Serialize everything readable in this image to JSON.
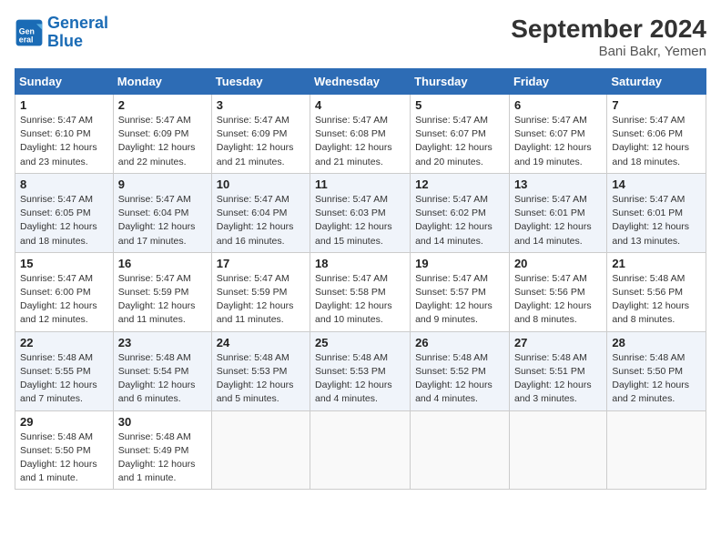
{
  "header": {
    "logo_general": "General",
    "logo_blue": "Blue",
    "month_year": "September 2024",
    "location": "Bani Bakr, Yemen"
  },
  "days_of_week": [
    "Sunday",
    "Monday",
    "Tuesday",
    "Wednesday",
    "Thursday",
    "Friday",
    "Saturday"
  ],
  "weeks": [
    [
      {
        "day": "1",
        "sunrise": "Sunrise: 5:47 AM",
        "sunset": "Sunset: 6:10 PM",
        "daylight": "Daylight: 12 hours and 23 minutes."
      },
      {
        "day": "2",
        "sunrise": "Sunrise: 5:47 AM",
        "sunset": "Sunset: 6:09 PM",
        "daylight": "Daylight: 12 hours and 22 minutes."
      },
      {
        "day": "3",
        "sunrise": "Sunrise: 5:47 AM",
        "sunset": "Sunset: 6:09 PM",
        "daylight": "Daylight: 12 hours and 21 minutes."
      },
      {
        "day": "4",
        "sunrise": "Sunrise: 5:47 AM",
        "sunset": "Sunset: 6:08 PM",
        "daylight": "Daylight: 12 hours and 21 minutes."
      },
      {
        "day": "5",
        "sunrise": "Sunrise: 5:47 AM",
        "sunset": "Sunset: 6:07 PM",
        "daylight": "Daylight: 12 hours and 20 minutes."
      },
      {
        "day": "6",
        "sunrise": "Sunrise: 5:47 AM",
        "sunset": "Sunset: 6:07 PM",
        "daylight": "Daylight: 12 hours and 19 minutes."
      },
      {
        "day": "7",
        "sunrise": "Sunrise: 5:47 AM",
        "sunset": "Sunset: 6:06 PM",
        "daylight": "Daylight: 12 hours and 18 minutes."
      }
    ],
    [
      {
        "day": "8",
        "sunrise": "Sunrise: 5:47 AM",
        "sunset": "Sunset: 6:05 PM",
        "daylight": "Daylight: 12 hours and 18 minutes."
      },
      {
        "day": "9",
        "sunrise": "Sunrise: 5:47 AM",
        "sunset": "Sunset: 6:04 PM",
        "daylight": "Daylight: 12 hours and 17 minutes."
      },
      {
        "day": "10",
        "sunrise": "Sunrise: 5:47 AM",
        "sunset": "Sunset: 6:04 PM",
        "daylight": "Daylight: 12 hours and 16 minutes."
      },
      {
        "day": "11",
        "sunrise": "Sunrise: 5:47 AM",
        "sunset": "Sunset: 6:03 PM",
        "daylight": "Daylight: 12 hours and 15 minutes."
      },
      {
        "day": "12",
        "sunrise": "Sunrise: 5:47 AM",
        "sunset": "Sunset: 6:02 PM",
        "daylight": "Daylight: 12 hours and 14 minutes."
      },
      {
        "day": "13",
        "sunrise": "Sunrise: 5:47 AM",
        "sunset": "Sunset: 6:01 PM",
        "daylight": "Daylight: 12 hours and 14 minutes."
      },
      {
        "day": "14",
        "sunrise": "Sunrise: 5:47 AM",
        "sunset": "Sunset: 6:01 PM",
        "daylight": "Daylight: 12 hours and 13 minutes."
      }
    ],
    [
      {
        "day": "15",
        "sunrise": "Sunrise: 5:47 AM",
        "sunset": "Sunset: 6:00 PM",
        "daylight": "Daylight: 12 hours and 12 minutes."
      },
      {
        "day": "16",
        "sunrise": "Sunrise: 5:47 AM",
        "sunset": "Sunset: 5:59 PM",
        "daylight": "Daylight: 12 hours and 11 minutes."
      },
      {
        "day": "17",
        "sunrise": "Sunrise: 5:47 AM",
        "sunset": "Sunset: 5:59 PM",
        "daylight": "Daylight: 12 hours and 11 minutes."
      },
      {
        "day": "18",
        "sunrise": "Sunrise: 5:47 AM",
        "sunset": "Sunset: 5:58 PM",
        "daylight": "Daylight: 12 hours and 10 minutes."
      },
      {
        "day": "19",
        "sunrise": "Sunrise: 5:47 AM",
        "sunset": "Sunset: 5:57 PM",
        "daylight": "Daylight: 12 hours and 9 minutes."
      },
      {
        "day": "20",
        "sunrise": "Sunrise: 5:47 AM",
        "sunset": "Sunset: 5:56 PM",
        "daylight": "Daylight: 12 hours and 8 minutes."
      },
      {
        "day": "21",
        "sunrise": "Sunrise: 5:48 AM",
        "sunset": "Sunset: 5:56 PM",
        "daylight": "Daylight: 12 hours and 8 minutes."
      }
    ],
    [
      {
        "day": "22",
        "sunrise": "Sunrise: 5:48 AM",
        "sunset": "Sunset: 5:55 PM",
        "daylight": "Daylight: 12 hours and 7 minutes."
      },
      {
        "day": "23",
        "sunrise": "Sunrise: 5:48 AM",
        "sunset": "Sunset: 5:54 PM",
        "daylight": "Daylight: 12 hours and 6 minutes."
      },
      {
        "day": "24",
        "sunrise": "Sunrise: 5:48 AM",
        "sunset": "Sunset: 5:53 PM",
        "daylight": "Daylight: 12 hours and 5 minutes."
      },
      {
        "day": "25",
        "sunrise": "Sunrise: 5:48 AM",
        "sunset": "Sunset: 5:53 PM",
        "daylight": "Daylight: 12 hours and 4 minutes."
      },
      {
        "day": "26",
        "sunrise": "Sunrise: 5:48 AM",
        "sunset": "Sunset: 5:52 PM",
        "daylight": "Daylight: 12 hours and 4 minutes."
      },
      {
        "day": "27",
        "sunrise": "Sunrise: 5:48 AM",
        "sunset": "Sunset: 5:51 PM",
        "daylight": "Daylight: 12 hours and 3 minutes."
      },
      {
        "day": "28",
        "sunrise": "Sunrise: 5:48 AM",
        "sunset": "Sunset: 5:50 PM",
        "daylight": "Daylight: 12 hours and 2 minutes."
      }
    ],
    [
      {
        "day": "29",
        "sunrise": "Sunrise: 5:48 AM",
        "sunset": "Sunset: 5:50 PM",
        "daylight": "Daylight: 12 hours and 1 minute."
      },
      {
        "day": "30",
        "sunrise": "Sunrise: 5:48 AM",
        "sunset": "Sunset: 5:49 PM",
        "daylight": "Daylight: 12 hours and 1 minute."
      },
      null,
      null,
      null,
      null,
      null
    ]
  ]
}
